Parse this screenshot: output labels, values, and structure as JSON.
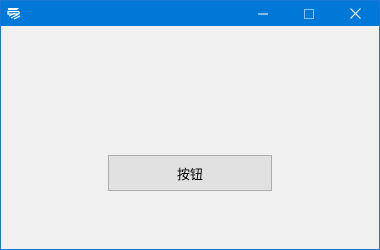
{
  "window": {
    "title": "",
    "accent_color": "#0078d7",
    "client_background": "#f0f0f0",
    "icons": {
      "app": "app-logo-icon",
      "minimize": "minimize-icon",
      "maximize": "maximize-icon",
      "close": "close-icon"
    }
  },
  "main": {
    "button_label": "按钮"
  }
}
